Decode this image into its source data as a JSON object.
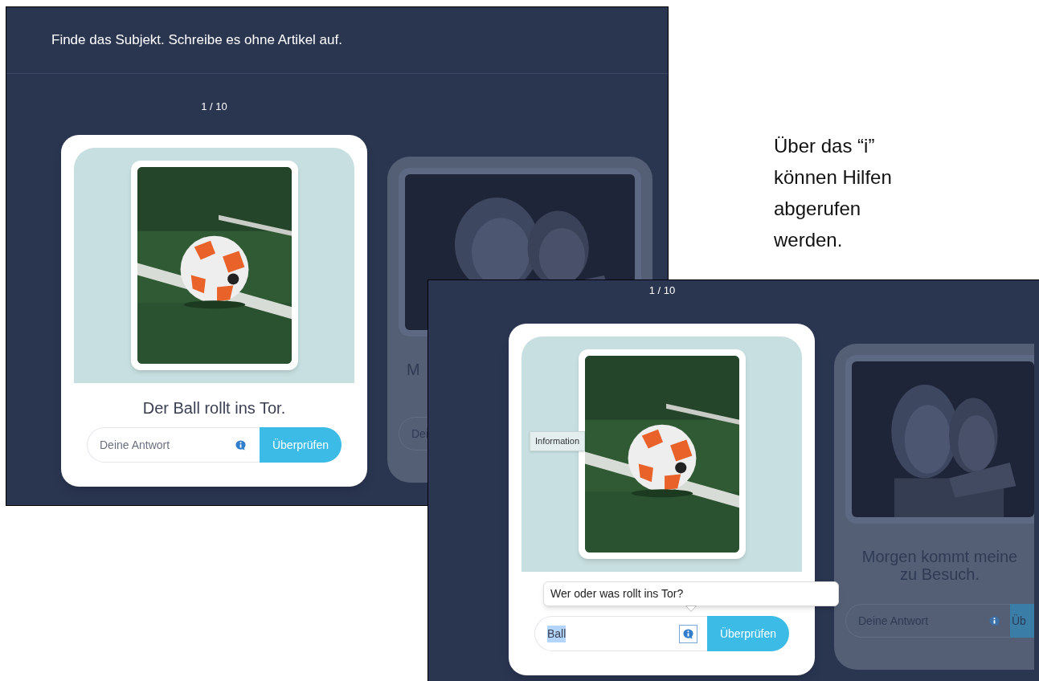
{
  "note": "Über das “i” können Hilfen abgerufen werden.",
  "screenshot_1": {
    "instruction": "Finde das Subjekt. Schreibe es ohne Artikel auf.",
    "counter": "1 / 10",
    "cards": [
      {
        "kind": "current",
        "sentence": "Der Ball rollt ins Tor.",
        "placeholder": "Deine Antwort",
        "info_focused": false,
        "button": "Überprüfen"
      },
      {
        "kind": "next",
        "sentence": "M",
        "placeholder": "Dei"
      }
    ]
  },
  "screenshot_2": {
    "counter": "1 / 10",
    "tooltip": "Information",
    "hint": "Wer oder was rollt ins Tor?",
    "cards": [
      {
        "kind": "current",
        "value": "Ball",
        "selected": true,
        "info_focused": true,
        "button": "Überprüfen"
      },
      {
        "kind": "next",
        "sentence_lines": [
          "Morgen kommt meine",
          "zu Besuch."
        ],
        "placeholder": "Deine Antwort",
        "button": "Üb"
      }
    ]
  }
}
